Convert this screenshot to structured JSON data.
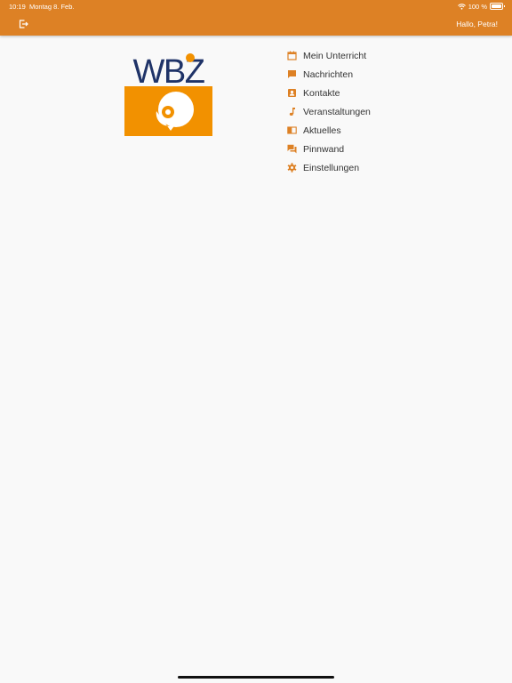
{
  "status_bar": {
    "time": "10:19",
    "date": "Montag 8. Feb.",
    "battery": "100 %"
  },
  "header": {
    "greeting": "Hallo, Petra!"
  },
  "brand": {
    "name": "WBZ"
  },
  "menu": [
    {
      "label": "Mein Unterricht",
      "icon": "calendar-icon"
    },
    {
      "label": "Nachrichten",
      "icon": "message-icon"
    },
    {
      "label": "Kontakte",
      "icon": "contact-card-icon"
    },
    {
      "label": "Veranstaltungen",
      "icon": "music-note-icon"
    },
    {
      "label": "Aktuelles",
      "icon": "news-icon"
    },
    {
      "label": "Pinnwand",
      "icon": "forum-icon"
    },
    {
      "label": "Einstellungen",
      "icon": "gear-icon"
    }
  ],
  "colors": {
    "accent": "#dd8125",
    "logo_blue": "#1f3368",
    "logo_orange": "#f29100",
    "text": "#333333",
    "background": "#f9f9f9"
  }
}
